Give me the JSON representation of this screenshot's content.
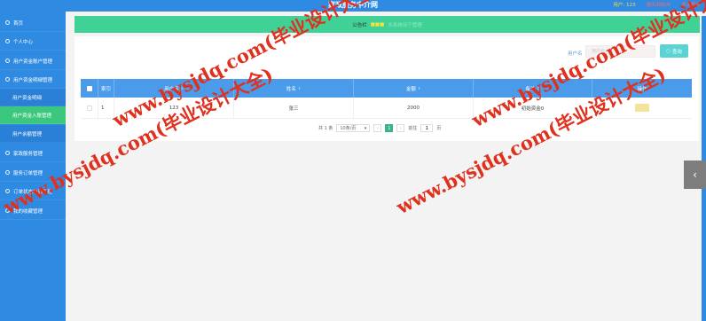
{
  "header": {
    "title": "家政服务中介网",
    "user_info": "用户: 123",
    "link_front": "退出到前台",
    "link_logout": "退出登录"
  },
  "sidebar": {
    "items": [
      {
        "label": "首页",
        "icon": "home-icon"
      },
      {
        "label": "个人中心",
        "icon": "user-icon"
      },
      {
        "label": "用户资金账户管理",
        "icon": "wallet-icon"
      },
      {
        "label": "用户资金明细管理",
        "icon": "list-icon"
      },
      {
        "label": "用户资金明细",
        "sub": true
      },
      {
        "label": "用户资金入账管理",
        "sub": true,
        "active": true
      },
      {
        "label": "用户余额管理",
        "sub": true
      },
      {
        "label": "家政服务管理",
        "icon": "service-icon"
      },
      {
        "label": "服务订单管理",
        "icon": "order-icon"
      },
      {
        "label": "订单状态申请管理",
        "icon": "status-icon"
      },
      {
        "label": "我的收藏管理",
        "icon": "star-icon"
      }
    ]
  },
  "notice": {
    "label": "公告栏",
    "sub": "本系统用于管理"
  },
  "search": {
    "label": "用户名",
    "placeholder": "用户名",
    "button_label": "查询",
    "button_icon": "search-icon"
  },
  "table": {
    "columns": [
      "索引",
      "用户名",
      "姓名",
      "金额",
      "备注",
      "操作"
    ],
    "rows": [
      {
        "index": "1",
        "username": "123",
        "name": "张三",
        "amount": "2000",
        "remark": "初始资金0"
      }
    ]
  },
  "pagination": {
    "total": "共 1 条",
    "page_size": "10条/页",
    "prev": "‹",
    "current": "1",
    "next": "›",
    "goto_label": "前往",
    "goto_value": "1",
    "page_unit": "页"
  },
  "watermark": "www.bysjdq.com(毕业设计大全)",
  "colors": {
    "primary": "#2f8ae2",
    "notice": "#3fd196",
    "active_menu": "#3cc77f",
    "table_header": "#4a9bea",
    "watermark": "#e0301e"
  }
}
